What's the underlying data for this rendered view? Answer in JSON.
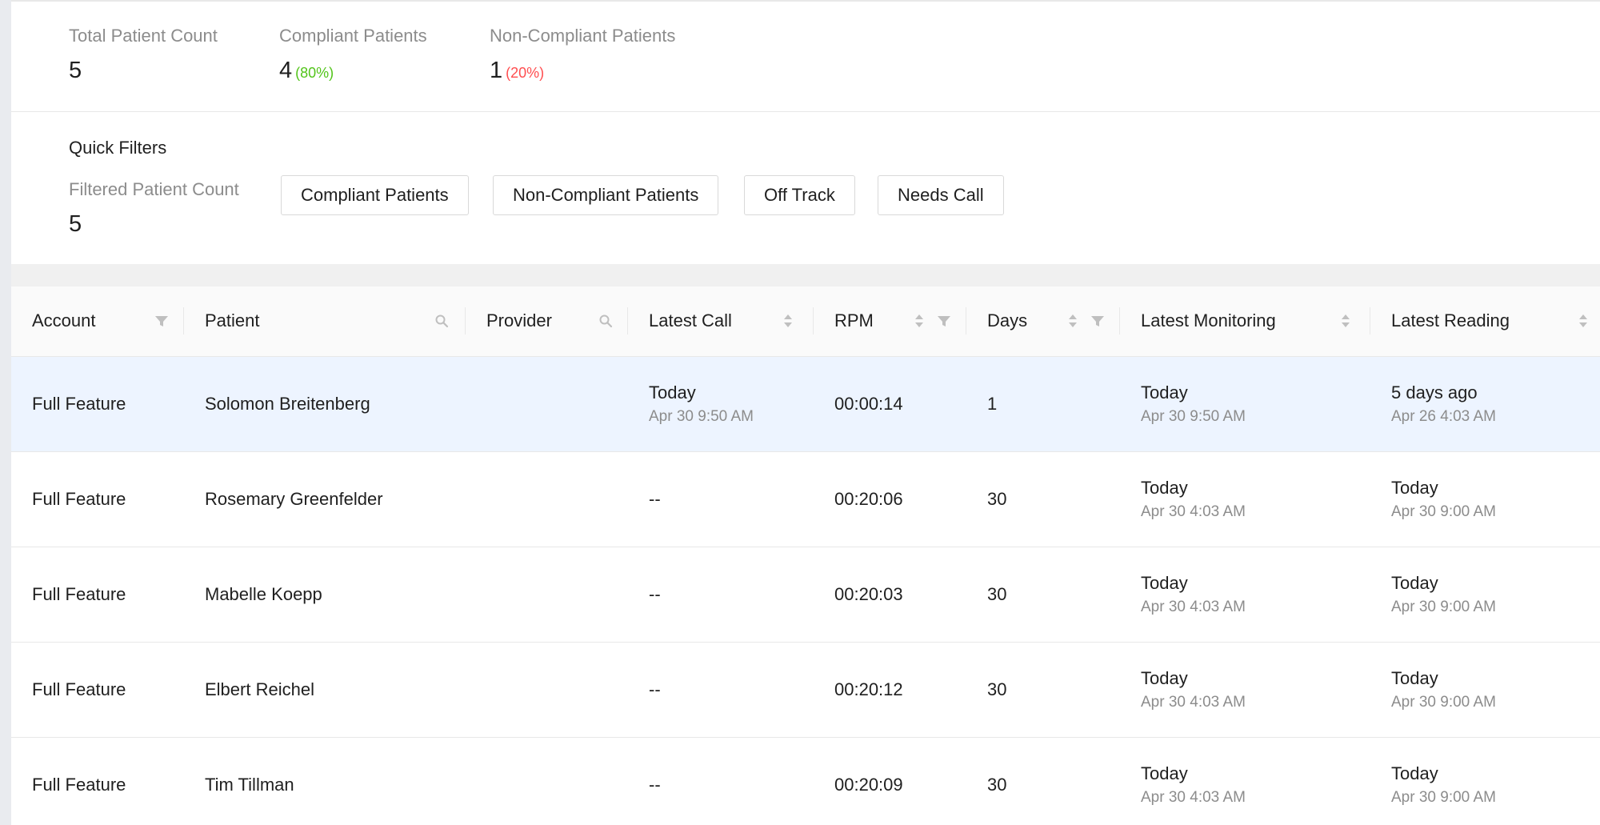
{
  "stats": {
    "total": {
      "label": "Total Patient Count",
      "value": "5"
    },
    "compliant": {
      "label": "Compliant Patients",
      "value": "4",
      "pct": "(80%)"
    },
    "non_compliant": {
      "label": "Non-Compliant Patients",
      "value": "1",
      "pct": "(20%)"
    }
  },
  "quick_filters": {
    "title": "Quick Filters",
    "filtered_label": "Filtered Patient Count",
    "filtered_value": "5",
    "buttons": [
      "Compliant Patients",
      "Non-Compliant Patients",
      "Off Track",
      "Needs Call"
    ]
  },
  "table": {
    "columns": [
      {
        "label": "Account",
        "icons": [
          "filter-icon"
        ]
      },
      {
        "label": "Patient",
        "icons": [
          "search-icon"
        ]
      },
      {
        "label": "Provider",
        "icons": [
          "search-icon"
        ]
      },
      {
        "label": "Latest Call",
        "icons": [
          "sort-icon"
        ]
      },
      {
        "label": "RPM",
        "icons": [
          "sort-icon",
          "filter-icon"
        ]
      },
      {
        "label": "Days",
        "icons": [
          "sort-icon",
          "filter-icon"
        ]
      },
      {
        "label": "Latest Monitoring",
        "icons": [
          "sort-icon"
        ]
      },
      {
        "label": "Latest Reading",
        "icons": [
          "sort-icon"
        ]
      }
    ],
    "rows": [
      {
        "account": "Full Feature",
        "patient": "Solomon Breitenberg",
        "provider": "",
        "latest_call": {
          "primary": "Today",
          "secondary": "Apr 30 9:50 AM"
        },
        "rpm": "00:00:14",
        "days": "1",
        "latest_monitoring": {
          "primary": "Today",
          "secondary": "Apr 30 9:50 AM"
        },
        "latest_reading": {
          "primary": "5 days ago",
          "secondary": "Apr 26 4:03 AM"
        }
      },
      {
        "account": "Full Feature",
        "patient": "Rosemary Greenfelder",
        "provider": "",
        "latest_call": {
          "primary": "--",
          "secondary": ""
        },
        "rpm": "00:20:06",
        "days": "30",
        "latest_monitoring": {
          "primary": "Today",
          "secondary": "Apr 30 4:03 AM"
        },
        "latest_reading": {
          "primary": "Today",
          "secondary": "Apr 30 9:00 AM"
        }
      },
      {
        "account": "Full Feature",
        "patient": "Mabelle Koepp",
        "provider": "",
        "latest_call": {
          "primary": "--",
          "secondary": ""
        },
        "rpm": "00:20:03",
        "days": "30",
        "latest_monitoring": {
          "primary": "Today",
          "secondary": "Apr 30 4:03 AM"
        },
        "latest_reading": {
          "primary": "Today",
          "secondary": "Apr 30 9:00 AM"
        }
      },
      {
        "account": "Full Feature",
        "patient": "Elbert Reichel",
        "provider": "",
        "latest_call": {
          "primary": "--",
          "secondary": ""
        },
        "rpm": "00:20:12",
        "days": "30",
        "latest_monitoring": {
          "primary": "Today",
          "secondary": "Apr 30 4:03 AM"
        },
        "latest_reading": {
          "primary": "Today",
          "secondary": "Apr 30 9:00 AM"
        }
      },
      {
        "account": "Full Feature",
        "patient": "Tim Tillman",
        "provider": "",
        "latest_call": {
          "primary": "--",
          "secondary": ""
        },
        "rpm": "00:20:09",
        "days": "30",
        "latest_monitoring": {
          "primary": "Today",
          "secondary": "Apr 30 4:03 AM"
        },
        "latest_reading": {
          "primary": "Today",
          "secondary": "Apr 30 9:00 AM"
        }
      }
    ]
  },
  "colors": {
    "positive": "#52c41a",
    "negative": "#ff4d4f",
    "selected_row": "#edf4ff"
  }
}
